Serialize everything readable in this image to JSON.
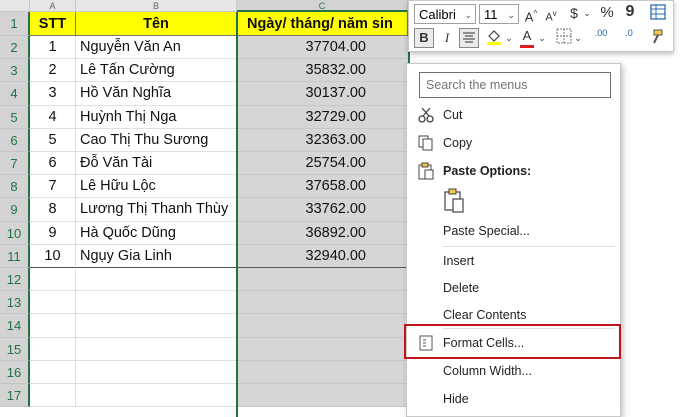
{
  "columns": [
    "A",
    "B",
    "C"
  ],
  "headers": {
    "stt": "STT",
    "name": "Tên",
    "date": "Ngày/ tháng/ năm sin"
  },
  "rows": [
    {
      "stt": "1",
      "name": "Nguyễn Văn An",
      "date": "37704.00"
    },
    {
      "stt": "2",
      "name": "Lê Tấn Cường",
      "date": "35832.00"
    },
    {
      "stt": "3",
      "name": "Hồ Văn Nghĩa",
      "date": "30137.00"
    },
    {
      "stt": "4",
      "name": "Huỳnh Thị Nga",
      "date": "32729.00"
    },
    {
      "stt": "5",
      "name": "Cao Thị Thu Sương",
      "date": "32363.00"
    },
    {
      "stt": "6",
      "name": "Đỗ Văn Tài",
      "date": "25754.00"
    },
    {
      "stt": "7",
      "name": "Lê Hữu Lộc",
      "date": "37658.00"
    },
    {
      "stt": "8",
      "name": "Lương Thị Thanh Thùy",
      "date": "33762.00"
    },
    {
      "stt": "9",
      "name": "Hà Quốc Dũng",
      "date": "36892.00"
    },
    {
      "stt": "10",
      "name": "Ngụy Gia Linh",
      "date": "32940.00"
    }
  ],
  "row_numbers": [
    "1",
    "2",
    "3",
    "4",
    "5",
    "6",
    "7",
    "8",
    "9",
    "10",
    "11",
    "12",
    "13",
    "14",
    "15",
    "16",
    "17"
  ],
  "toolbar": {
    "font": "Calibri",
    "size": "11",
    "grow": "A",
    "shrink": "A",
    "currency": "$",
    "percent": "%",
    "comma": "9",
    "bold": "B",
    "italic": "I",
    "font_color_letter": "A",
    "inc_decimal": ".00",
    "dec_decimal": ".0"
  },
  "menu": {
    "search_placeholder": "Search the menus",
    "cut": "Cut",
    "copy": "Copy",
    "paste_options": "Paste Options:",
    "paste_special": "Paste Special...",
    "insert": "Insert",
    "delete": "Delete",
    "clear_contents": "Clear Contents",
    "format_cells": "Format Cells...",
    "column_width": "Column Width...",
    "hide": "Hide"
  },
  "colors": {
    "accent": "#217346",
    "header_fill": "#ffff00",
    "highlight": "#c0141d",
    "selection": "#d6d6d6"
  }
}
